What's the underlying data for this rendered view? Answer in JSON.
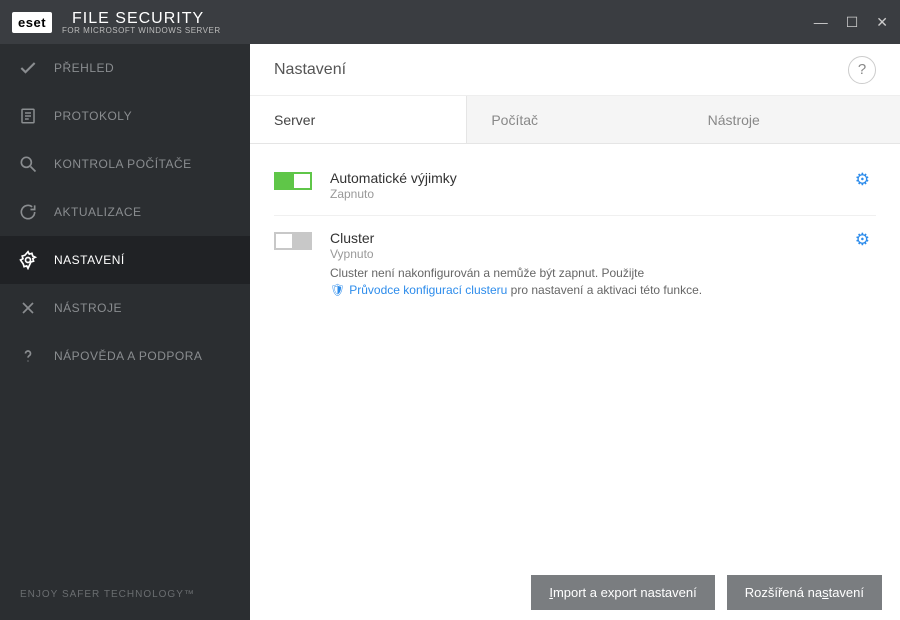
{
  "brand": {
    "logo": "eset",
    "title": "FILE SECURITY",
    "subtitle": "FOR MICROSOFT WINDOWS SERVER"
  },
  "sidebar": {
    "items": [
      {
        "label": "PŘEHLED"
      },
      {
        "label": "PROTOKOLY"
      },
      {
        "label": "KONTROLA POČÍTAČE"
      },
      {
        "label": "AKTUALIZACE"
      },
      {
        "label": "NASTAVENÍ"
      },
      {
        "label": "NÁSTROJE"
      },
      {
        "label": "NÁPOVĚDA A PODPORA"
      }
    ],
    "footer": "ENJOY SAFER TECHNOLOGY™"
  },
  "page": {
    "title": "Nastavení"
  },
  "tabs": [
    {
      "label": "Server"
    },
    {
      "label": "Počítač"
    },
    {
      "label": "Nástroje"
    }
  ],
  "settings": {
    "auto_exclusions": {
      "title": "Automatické výjimky",
      "status": "Zapnuto"
    },
    "cluster": {
      "title": "Cluster",
      "status": "Vypnuto",
      "desc_before": "Cluster není nakonfigurován a nemůže být zapnut. Použijte",
      "link": "Průvodce konfigurací clusteru",
      "desc_after": "pro nastavení a aktivaci této funkce."
    }
  },
  "footer": {
    "import_export": "Import a export nastavení",
    "advanced": "Rozšířená nastavení"
  }
}
